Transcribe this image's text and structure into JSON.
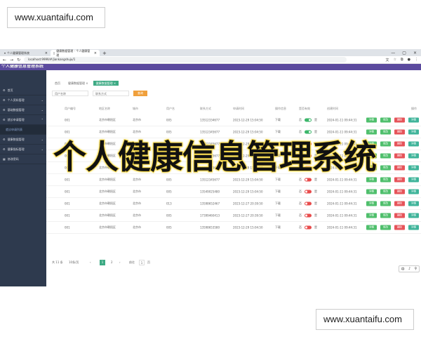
{
  "watermarks": [
    "www.xuantaifu.com",
    "www.xuantaifu.com"
  ],
  "browser": {
    "tabs": [
      {
        "label": "个人健康管理系统"
      },
      {
        "label": "健康数据管理 - 个人健康管理"
      }
    ],
    "url": "localhost:9999/#/jiankangshuju/1"
  },
  "app": {
    "title": "个人健康信息管理系统"
  },
  "overlay_title": "个人健康信息管理系统",
  "sidebar": {
    "items": [
      {
        "label": "首页"
      },
      {
        "label": "个人资料管理"
      },
      {
        "label": "基础数据管理"
      },
      {
        "label": "就诊申请管理"
      },
      {
        "label": "就诊申请列表"
      },
      {
        "label": "健康数据管理"
      },
      {
        "label": "健康指标管理"
      },
      {
        "label": "修改密码"
      }
    ]
  },
  "breadcrumbs": [
    {
      "label": "首页"
    },
    {
      "label": "健康数据管理"
    },
    {
      "label": "健康数据管理"
    }
  ],
  "search": {
    "placeholder1": "用户名称",
    "placeholder2": "联系方式",
    "button": "查询"
  },
  "table": {
    "headers": [
      "用户编号",
      "地区名称",
      "城市",
      "用户名",
      "联系方式",
      "申请时间",
      "操作信息",
      "是否有效",
      "创建时间",
      "操作"
    ],
    "rows": [
      {
        "c1": "001",
        "c2": "北京市朝阳区",
        "c3": "北京市",
        "c4": "005",
        "c5": "13512334677",
        "c6": "2023-12-29 15:04:50",
        "c7": "下载",
        "active": true,
        "c9": "2024-01-11 09:44:31"
      },
      {
        "c1": "001",
        "c2": "北京市朝阳区",
        "c3": "北京市",
        "c4": "005",
        "c5": "13512345677",
        "c6": "2023-12-29 15:04:50",
        "c7": "下载",
        "active": true,
        "c9": "2024-01-11 09:44:31"
      },
      {
        "c1": "001",
        "c2": "北京市朝阳区",
        "c3": "北京市",
        "c4": "005",
        "c5": "13512345677",
        "c6": "2023-12-29 15:04:50",
        "c7": "下载",
        "active": false,
        "c9": "2024-01-11 09:44:31"
      },
      {
        "c1": "001",
        "c2": "北京市朝阳区",
        "c3": "北京市",
        "c4": "005",
        "c5": "13512345677",
        "c6": "2023-12-29 15:04:50",
        "c7": "下载",
        "active": false,
        "c9": "2024-01-11 09:44:31"
      },
      {
        "c1": "001",
        "c2": "北京市朝阳区",
        "c3": "北京市",
        "c4": "005",
        "c5": "13512345677",
        "c6": "2023-12-29 15:04:50",
        "c7": "下载",
        "active": false,
        "c9": "2024-01-11 09:44:31"
      },
      {
        "c1": "001",
        "c2": "北京市朝阳区",
        "c3": "北京市",
        "c4": "005",
        "c5": "13512345677",
        "c6": "2023-12-29 15:04:50",
        "c7": "下载",
        "active": false,
        "c9": "2024-01-11 09:44:31"
      },
      {
        "c1": "001",
        "c2": "北京市朝阳区",
        "c3": "北京市",
        "c4": "005",
        "c5": "13549025480",
        "c6": "2023-12-29 15:04:50",
        "c7": "下载",
        "active": false,
        "c9": "2024-01-11 09:44:31"
      },
      {
        "c1": "001",
        "c2": "北京市朝阳区",
        "c3": "北京市",
        "c4": "013",
        "c5": "13598652467",
        "c6": "2023-12-27 20:39:50",
        "c7": "下载",
        "active": false,
        "c9": "2024-01-11 09:44:31"
      },
      {
        "c1": "001",
        "c2": "北京市朝阳区",
        "c3": "北京市",
        "c4": "005",
        "c5": "17399460413",
        "c6": "2023-12-27 20:39:50",
        "c7": "下载",
        "active": false,
        "c9": "2024-01-11 09:44:31"
      },
      {
        "c1": "001",
        "c2": "北京市朝阳区",
        "c3": "北京市",
        "c4": "005",
        "c5": "13598653580",
        "c6": "2023-12-29 15:04:50",
        "c7": "下载",
        "active": false,
        "c9": "2024-01-11 09:44:31"
      }
    ],
    "actions": [
      "详情",
      "修改",
      "删除",
      "详情"
    ]
  },
  "pager": {
    "total": "共 11 条",
    "size": "10条/页",
    "pages": [
      "1",
      "2"
    ],
    "jump": "前往",
    "unit": "页"
  },
  "minibar": {
    "items": [
      "中",
      "♪",
      "⚲"
    ]
  }
}
